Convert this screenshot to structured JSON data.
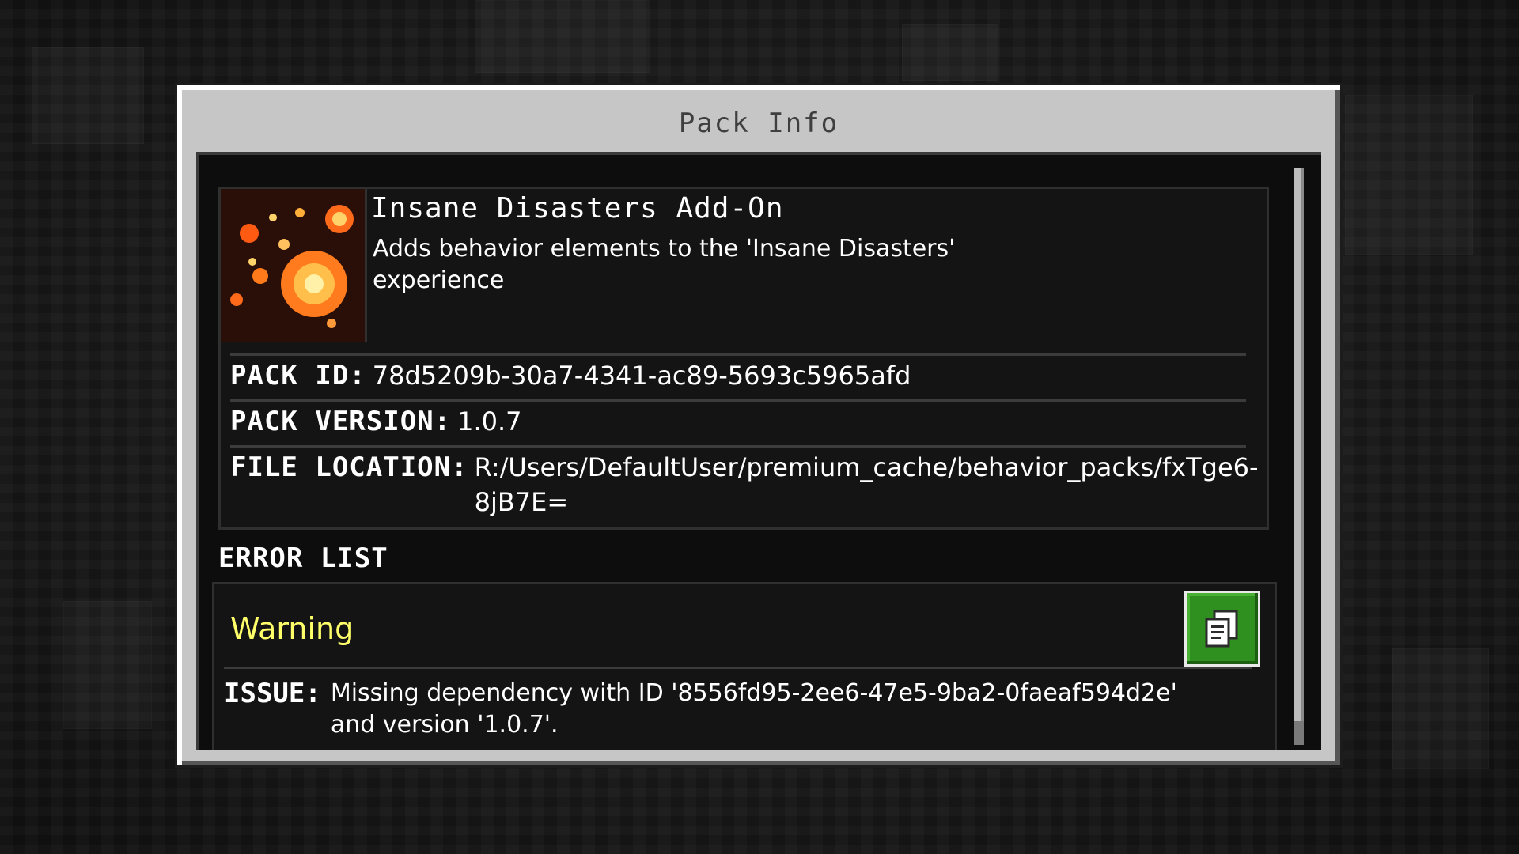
{
  "dialog": {
    "title": "Pack Info"
  },
  "pack": {
    "name": "Insane Disasters Add-On",
    "description": "Adds behavior elements to the 'Insane Disasters' experience",
    "thumbnail_icon": "meteor-fire-image",
    "id_label": "PACK ID:",
    "id": "78d5209b-30a7-4341-ac89-5693c5965afd",
    "version_label": "PACK VERSION:",
    "version": "1.0.7",
    "location_label": "FILE LOCATION:",
    "location": "R:/Users/DefaultUser/premium_cache/behavior_packs/fxTge6-8jB7E="
  },
  "errors": {
    "heading": "ERROR LIST",
    "items": [
      {
        "level": "Warning",
        "issue_label": "ISSUE:",
        "issue": "Missing dependency with ID '8556fd95-2ee6-47e5-9ba2-0faeaf594d2e' and version '1.0.7'.",
        "copy_icon": "copy-icon"
      }
    ]
  },
  "colors": {
    "warning": "#ffff6a",
    "copy_button": "#2f8f1f",
    "dialog_frame": "#c6c6c6",
    "content_bg": "#0d0d0d"
  }
}
